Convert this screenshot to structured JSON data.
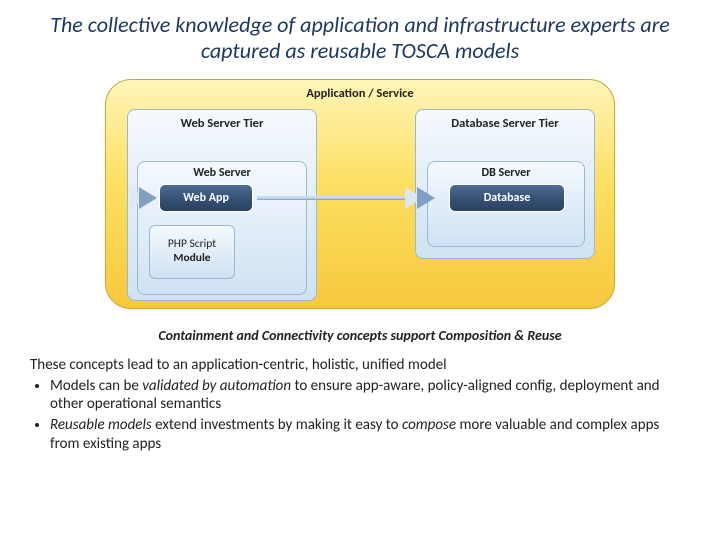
{
  "title": "The collective knowledge of application and infrastructure experts are captured as reusable TOSCA models",
  "diagram": {
    "outer_label": "Application / Service",
    "left_tier": "Web Server Tier",
    "right_tier": "Database Server Tier",
    "web_server": "Web Server",
    "db_server": "DB Server",
    "web_app": "Web App",
    "database": "Database",
    "php_line1": "PHP Script",
    "php_line2": "Module"
  },
  "caption": "Containment and Connectivity concepts support Composition & Reuse",
  "body": {
    "lead": "These concepts lead to an application-centric, holistic, unified model",
    "bullet1_pre": "Models can be ",
    "bullet1_em": "validated by automation",
    "bullet1_post": " to ensure app-aware, policy-aligned config, deployment and other operational semantics",
    "bullet2_em1": "Reusable models",
    "bullet2_mid": " extend investments by making it easy to ",
    "bullet2_em2": "compose",
    "bullet2_post": " more valuable and complex apps from existing apps"
  }
}
